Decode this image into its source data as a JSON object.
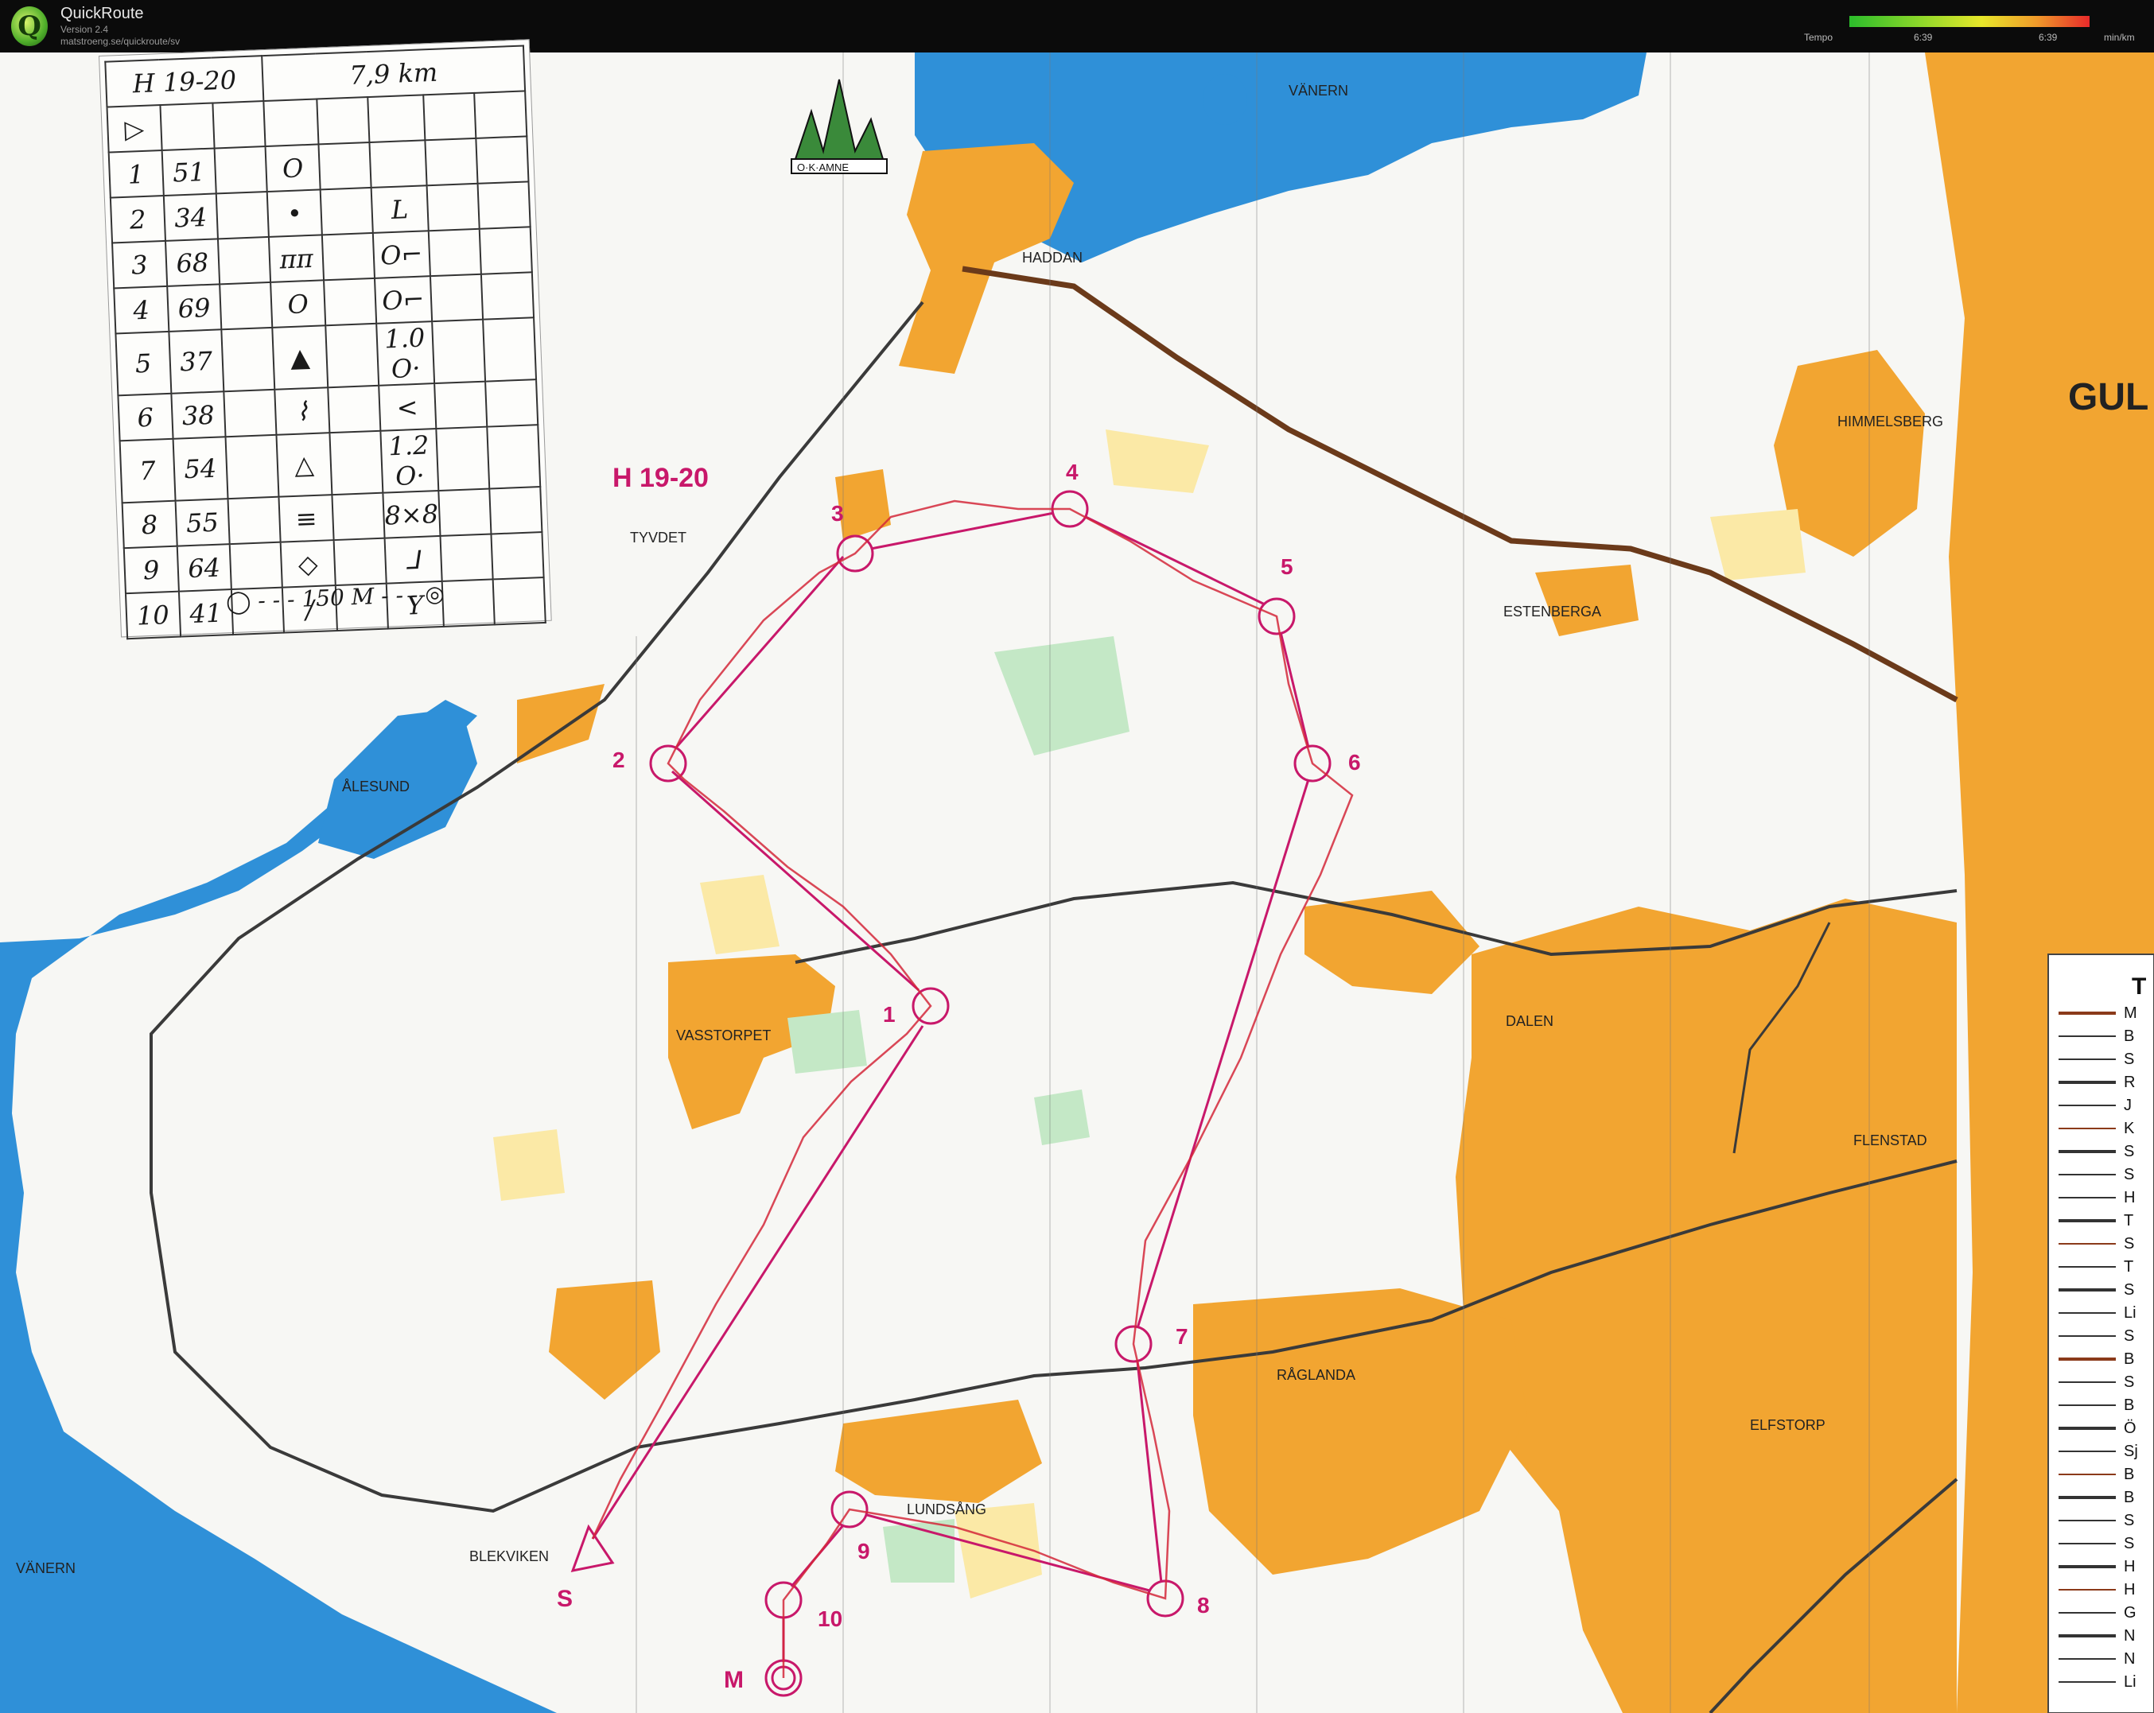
{
  "app": {
    "logo_letter": "Q",
    "title": "QuickRoute",
    "version": "Version 2.4",
    "url": "matstroeng.se/quickroute/sv"
  },
  "tempo": {
    "label": "Tempo",
    "ticks": [
      "6:39",
      "6:39"
    ],
    "unit": "min/km"
  },
  "control_card": {
    "class": "H 19-20",
    "distance": "7,9 km",
    "rows": [
      {
        "num": "1",
        "code": "51",
        "symbol": "O",
        "extra": ""
      },
      {
        "num": "2",
        "code": "34",
        "symbol": "•",
        "extra": "L"
      },
      {
        "num": "3",
        "code": "68",
        "symbol": "ᴨᴨ",
        "extra": "O⌐"
      },
      {
        "num": "4",
        "code": "69",
        "symbol": "O",
        "extra": "O⌐"
      },
      {
        "num": "5",
        "code": "37",
        "symbol": "▲",
        "extra": "1.0 O·"
      },
      {
        "num": "6",
        "code": "38",
        "symbol": "⌇",
        "extra": "<"
      },
      {
        "num": "7",
        "code": "54",
        "symbol": "△",
        "extra": "1.2 O·"
      },
      {
        "num": "8",
        "code": "55",
        "symbol": "≡",
        "extra": "8×8"
      },
      {
        "num": "9",
        "code": "64",
        "symbol": "◇",
        "extra": "⅃"
      },
      {
        "num": "10",
        "code": "41",
        "symbol": "/",
        "extra": "Y"
      }
    ],
    "finish": "150 M"
  },
  "map_labels": {
    "club": "O·K·AMNE",
    "vanern_n": "VÄNERN",
    "vanern_sw": "VÄNERN",
    "haddan": "HADDAN",
    "tyvdet": "TYVDET",
    "alesund": "ÅLESUND",
    "estenberga": "ESTENBERGA",
    "himmelsberg": "HIMMELSBERG",
    "vasstorpet": "VASSTORPET",
    "dalen": "DALEN",
    "flenstad": "FLENSTAD",
    "raglanda": "RÅGLANDA",
    "elfstorp": "ELFSTORP",
    "lundsang": "LUNDSÅNG",
    "blekviken": "BLEKVIKEN",
    "gul": "GUL",
    "course_class": "H 19-20"
  },
  "course": {
    "start": "S",
    "finish": "M",
    "controls": [
      "1",
      "2",
      "3",
      "4",
      "5",
      "6",
      "7",
      "8",
      "9",
      "10"
    ]
  },
  "legend": {
    "title": "T",
    "items": [
      "M",
      "B",
      "S",
      "R",
      "J",
      "K",
      "S",
      "S",
      "H",
      "T",
      "S",
      "T",
      "S",
      "Li",
      "S",
      "B",
      "S",
      "B",
      "Ö",
      "Sj",
      "B",
      "B",
      "S",
      "S",
      "H",
      "H",
      "G",
      "N",
      "N",
      "Li"
    ]
  },
  "colors": {
    "water": "#2a8fd8",
    "field": "#f2a531",
    "rough": "#fbe9a6",
    "forest_green": "#bfe6c2",
    "course": "#c8186a",
    "route": "#d4283a",
    "road": "#3a3a3a"
  }
}
